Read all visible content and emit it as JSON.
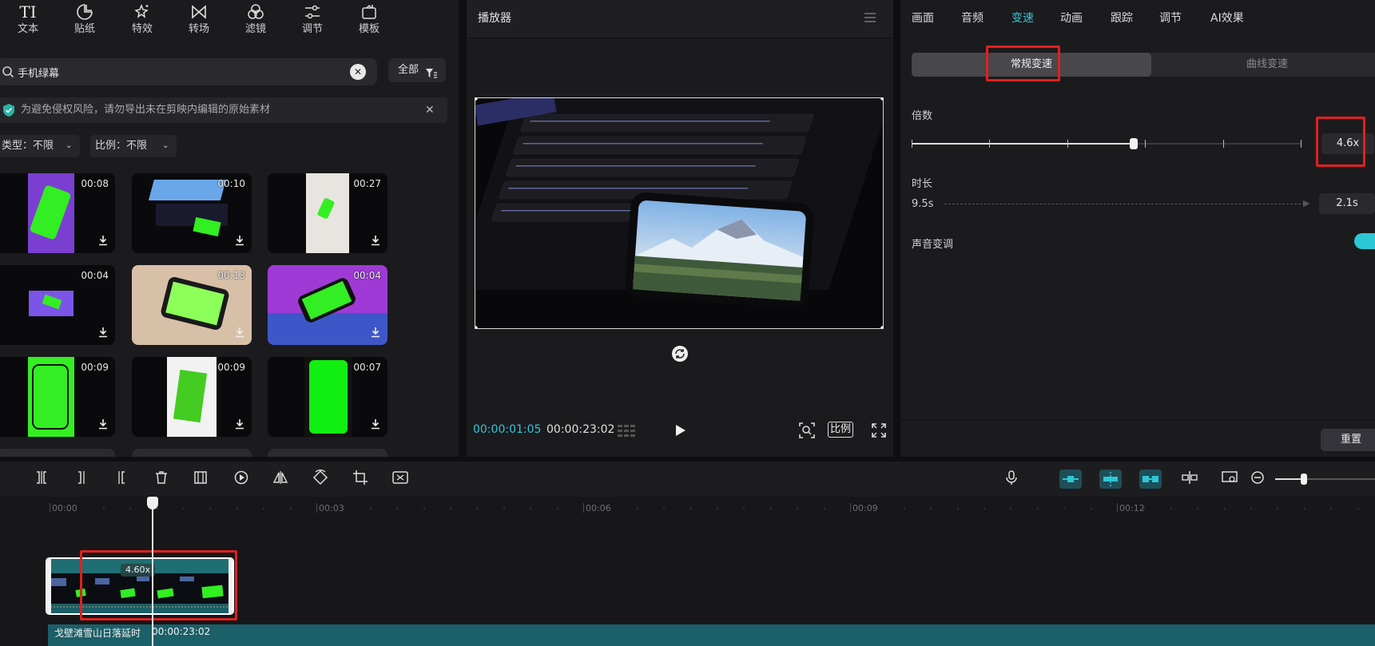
{
  "toolbar": {
    "items": [
      {
        "label": "文本",
        "icon": "text-icon"
      },
      {
        "label": "贴纸",
        "icon": "sticker-icon"
      },
      {
        "label": "特效",
        "icon": "effects-icon"
      },
      {
        "label": "转场",
        "icon": "transition-icon"
      },
      {
        "label": "滤镜",
        "icon": "filter-icon"
      },
      {
        "label": "调节",
        "icon": "adjust-icon"
      },
      {
        "label": "模板",
        "icon": "template-icon"
      }
    ],
    "text_glyph": "TI"
  },
  "search": {
    "value": "手机绿幕",
    "filter_label": "全部"
  },
  "notice": {
    "text": "为避免侵权风险，请勿导出未在剪映内编辑的原始素材"
  },
  "filters": {
    "type": "类型：不限",
    "ratio": "比例：不限"
  },
  "media": [
    {
      "duration": "00:08"
    },
    {
      "duration": "00:10"
    },
    {
      "duration": "00:27"
    },
    {
      "duration": "00:04"
    },
    {
      "duration": "00:13"
    },
    {
      "duration": "00:04"
    },
    {
      "duration": "00:09"
    },
    {
      "duration": "00:09"
    },
    {
      "duration": "00:07"
    }
  ],
  "player": {
    "title": "播放器",
    "current_time": "00:00:01:05",
    "total_time": "00:00:23:02",
    "ratio_label": "比例"
  },
  "props": {
    "tabs": [
      "画面",
      "音频",
      "变速",
      "动画",
      "跟踪",
      "调节",
      "AI效果"
    ],
    "active_tab": "变速",
    "seg_normal": "常规变速",
    "seg_curve": "曲线变速",
    "multiplier_label": "倍数",
    "multiplier_value": "4.6x",
    "multiplier_fraction": 0.57,
    "duration_label": "时长",
    "duration_from": "9.5s",
    "duration_to": "2.1s",
    "pitch_label": "声音变调",
    "reset_label": "重置"
  },
  "timeline": {
    "ruler": [
      "00:00",
      "00:03",
      "00:06",
      "00:09",
      "00:12"
    ],
    "clip_speed": "4.60x",
    "track_name": "戈壁滩雪山日落延时",
    "track_duration": "00:00:23:02"
  },
  "colors": {
    "accent": "#2ec7d6",
    "highlight": "#e02020",
    "green_screen": "#33ee22"
  }
}
